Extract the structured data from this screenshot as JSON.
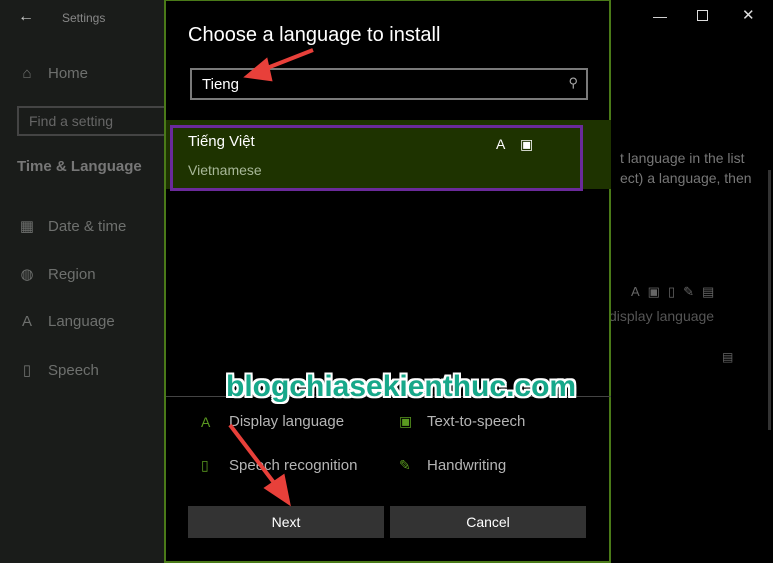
{
  "window": {
    "title": "Settings",
    "controls": [
      "minimize",
      "maximize",
      "close"
    ]
  },
  "sidebar": {
    "home": "Home",
    "search_placeholder": "Find a setting",
    "section": "Time & Language",
    "items": [
      {
        "label": "Date & time",
        "icon": "calendar-clock-icon"
      },
      {
        "label": "Region",
        "icon": "globe-icon"
      },
      {
        "label": "Language",
        "icon": "language-icon"
      },
      {
        "label": "Speech",
        "icon": "microphone-icon"
      }
    ]
  },
  "background": {
    "text1": "t language in the list",
    "text2": "ect) a language, then",
    "text3": "display language"
  },
  "dialog": {
    "title": "Choose a language to install",
    "search_value": "Tieng",
    "results": [
      {
        "name": "Tiếng Việt",
        "english": "Vietnamese",
        "features": [
          "display-language-icon",
          "text-to-speech-icon"
        ]
      }
    ],
    "legend": [
      {
        "label": "Display language",
        "icon": "display-language-icon"
      },
      {
        "label": "Text-to-speech",
        "icon": "text-to-speech-icon"
      },
      {
        "label": "Speech recognition",
        "icon": "microphone-icon"
      },
      {
        "label": "Handwriting",
        "icon": "handwriting-icon"
      }
    ],
    "next": "Next",
    "cancel": "Cancel"
  },
  "watermark": "blogchiasekienthuc.com",
  "colors": {
    "accent": "#4a7a18",
    "selected_row": "#1e3300",
    "highlight_box": "#6a2a9a",
    "arrow": "#e8403a",
    "watermark": "#17a88a"
  }
}
